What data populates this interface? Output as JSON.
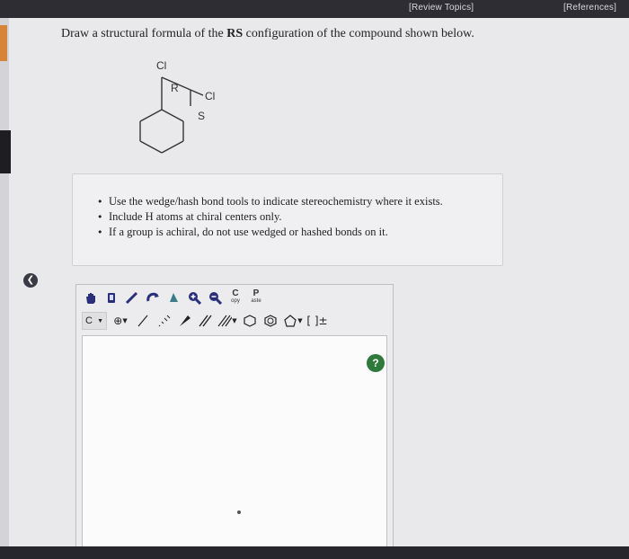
{
  "header": {
    "review_topics": "[Review Topics]",
    "references": "[References]"
  },
  "question": {
    "prefix": "Draw a structural formula of the ",
    "bold": "RS",
    "suffix": " configuration of the compound shown below."
  },
  "molecule": {
    "labels": {
      "cl_top": "Cl",
      "r": "R",
      "cl_right": "Cl",
      "s": "S"
    }
  },
  "instructions": [
    "Use the wedge/hash bond tools to indicate stereochemistry where it exists.",
    "Include H atoms at chiral centers only.",
    "If a group is achiral, do not use wedged or hashed bonds on it."
  ],
  "editor": {
    "copy_label": "C",
    "copy_sub": "opy",
    "paste_label": "P",
    "paste_sub": "aste",
    "atom_selector": "C",
    "charge_bracket": "[ ]±",
    "help": "?"
  },
  "icons": {
    "collapse": "chevron-left-icon",
    "help": "help-icon"
  },
  "colors": {
    "topbar": "#2d2d33",
    "accent_orange": "#d8833a",
    "help_green": "#2f7a3a"
  }
}
